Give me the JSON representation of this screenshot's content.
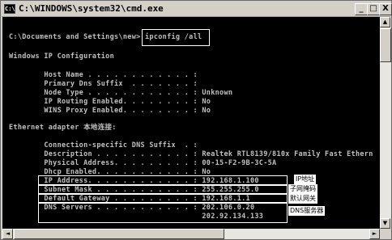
{
  "window": {
    "icon_text": "C:\\",
    "title": "C:\\WINDOWS\\system32\\cmd.exe",
    "minimize": "_",
    "maximize": "□",
    "close": "X"
  },
  "console": {
    "prompt": "C:\\Documents and Settings\\new>",
    "command": "ipconfig /all",
    "lines": [
      "Windows IP Configuration",
      "        Host Name . . . . . . . . . . . . :",
      "        Primary Dns Suffix  . . . . . . . :",
      "        Node Type . . . . . . . . . . . . : Unknown",
      "        IP Routing Enabled. . . . . . . . : No",
      "        WINS Proxy Enabled. . . . . . . . : No",
      "Ethernet adapter 本地连接:",
      "        Connection-specific DNS Suffix  . :",
      "        Description . . . . . . . . . . . : Realtek RTL8139/810x Family Fast Ethern",
      "        Physical Address. . . . . . . . . : 00-15-F2-9B-3C-5A",
      "        Dhcp Enabled. . . . . . . . . . . : No",
      "        IP Address. . . . . . . . . . . . : 192.168.1.100",
      "        Subnet Mask . . . . . . . . . . . : 255.255.255.0",
      "        Default Gateway . . . . . . . . . : 192.168.1.1",
      "        DNS Servers . . . . . . . . . . . : 202.106.0.20",
      "                                            202.92.134.133"
    ]
  },
  "annotations": {
    "ip": "IP地址",
    "mask": "子网掩码",
    "gateway": "默认网关",
    "dns": "DNS服务器"
  },
  "scroll": {
    "up": "▲",
    "down": "▼",
    "left": "◄",
    "right": "►"
  }
}
